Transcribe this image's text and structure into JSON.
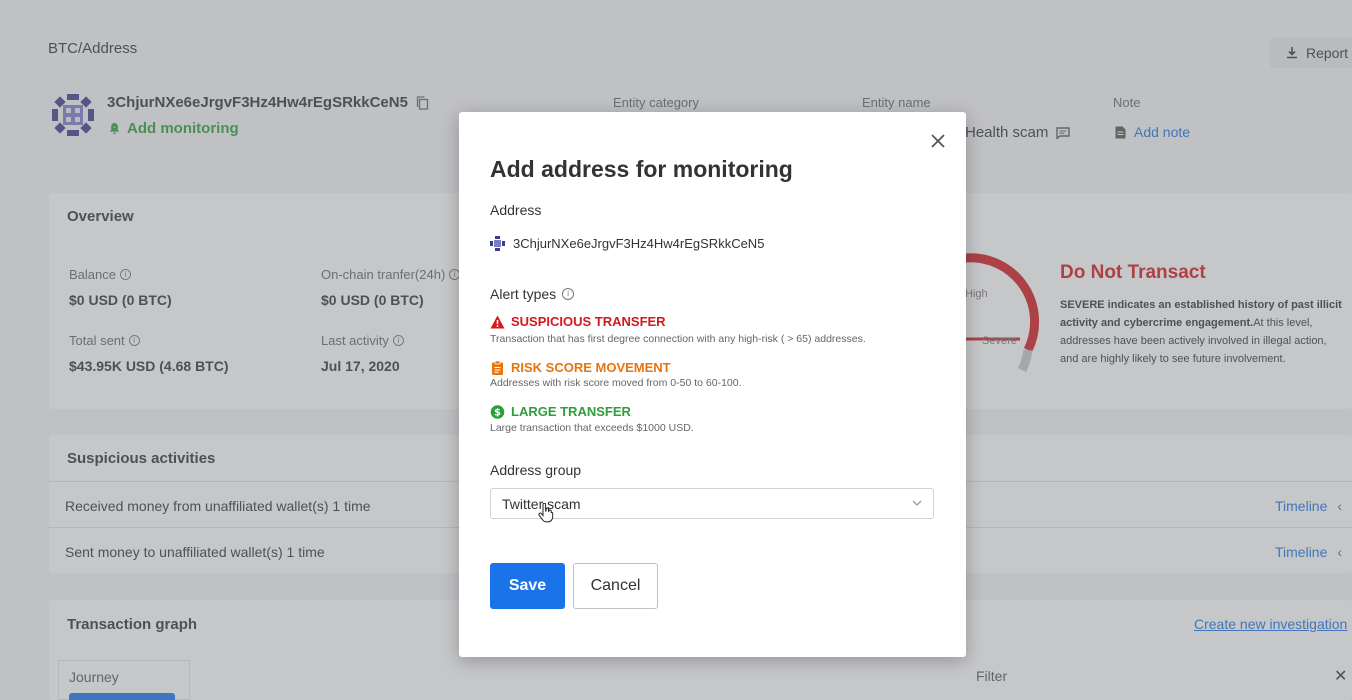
{
  "breadcrumb": "BTC/Address",
  "toolbar": {
    "report_label": "Report"
  },
  "header": {
    "address": "3ChjurNXe6eJrgvF3Hz4Hw4rEgSRkkCeN5",
    "add_monitoring": "Add monitoring",
    "entity_category_label": "Entity category",
    "entity_name_label": "Entity name",
    "entity_name_value": "rHealth scam",
    "note_label": "Note",
    "add_note": "Add note"
  },
  "overview": {
    "title": "Overview",
    "balance_label": "Balance",
    "balance_value": "$0 USD (0 BTC)",
    "onchain_label": "On-chain tranfer(24h)",
    "onchain_value": "$0 USD (0 BTC)",
    "total_sent_label": "Total sent",
    "total_sent_value": "$43.95K USD (4.68 BTC)",
    "last_activity_label": "Last activity",
    "last_activity_value": "Jul 17, 2020"
  },
  "risk": {
    "gauge_high": "High",
    "gauge_severe": "Severe",
    "title": "Do Not Transact",
    "desc_bold": "SEVERE indicates an established history of past illicit activity and cybercrime engagement.",
    "desc_rest": "At this level, addresses have been actively involved in illegal action, and are highly likely to see future involvement.",
    "color": "#d3191e"
  },
  "suspicious": {
    "title": "Suspicious activities",
    "rows": [
      {
        "text": "Received money from unaffiliated wallet(s) 1 time",
        "link": "Timeline"
      },
      {
        "text": "Sent money to unaffiliated wallet(s) 1 time",
        "link": "Timeline"
      }
    ]
  },
  "graph": {
    "title": "Transaction graph",
    "create_link": "Create new investigation",
    "journey": "Journey",
    "filter": "Filter"
  },
  "modal": {
    "title": "Add address for monitoring",
    "address_label": "Address",
    "address_value": "3ChjurNXe6eJrgvF3Hz4Hw4rEgSRkkCeN5",
    "alert_types_label": "Alert types",
    "alerts": [
      {
        "title": "SUSPICIOUS TRANSFER",
        "desc": "Transaction that has first degree connection with any high-risk ( > 65) addresses.",
        "color": "#d3191e",
        "icon": "warning-icon"
      },
      {
        "title": "RISK SCORE MOVEMENT",
        "desc": "Addresses with risk score moved from 0-50 to 60-100.",
        "color": "#e8740c",
        "icon": "clipboard-icon"
      },
      {
        "title": "LARGE TRANSFER",
        "desc": "Large transaction that exceeds $1000 USD.",
        "color": "#2e9e3a",
        "icon": "dollar-icon"
      }
    ],
    "group_label": "Address group",
    "group_value": "Twitter scam",
    "save_label": "Save",
    "cancel_label": "Cancel",
    "accent": "#1a73e8"
  }
}
